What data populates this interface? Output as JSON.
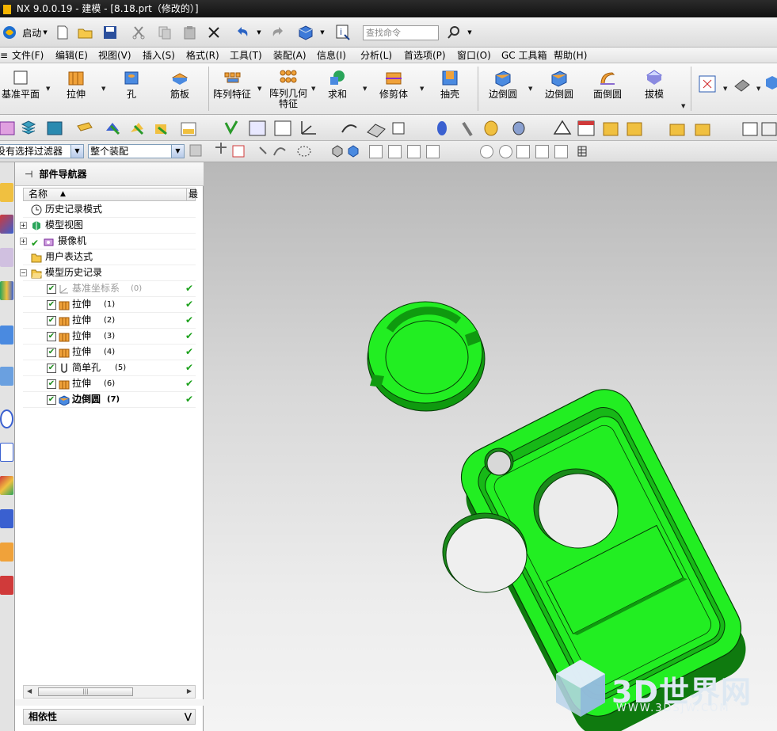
{
  "window": {
    "title": "NX 9.0.0.19 - 建模 - [8.18.prt（修改的）]"
  },
  "quickbar": {
    "start_label": "启动",
    "search_placeholder": "查找命令"
  },
  "menu": [
    {
      "label": "文件(F)"
    },
    {
      "label": "编辑(E)"
    },
    {
      "label": "视图(V)"
    },
    {
      "label": "插入(S)"
    },
    {
      "label": "格式(R)"
    },
    {
      "label": "工具(T)"
    },
    {
      "label": "装配(A)"
    },
    {
      "label": "信息(I)"
    },
    {
      "label": "分析(L)"
    },
    {
      "label": "首选项(P)"
    },
    {
      "label": "窗口(O)"
    },
    {
      "label": "GC 工具箱"
    },
    {
      "label": "帮助(H)"
    }
  ],
  "ribbon": [
    {
      "label": "基准平面",
      "icon": "datum-plane-icon"
    },
    {
      "label": "拉伸",
      "icon": "extrude-icon"
    },
    {
      "label": "孔",
      "icon": "hole-icon"
    },
    {
      "label": "筋板",
      "icon": "rib-icon"
    },
    {
      "label": "阵列特征",
      "icon": "pattern-feature-icon"
    },
    {
      "label": "阵列几何特征",
      "icon": "pattern-geometry-icon"
    },
    {
      "label": "求和",
      "icon": "unite-icon"
    },
    {
      "label": "修剪体",
      "icon": "trim-body-icon"
    },
    {
      "label": "抽壳",
      "icon": "shell-icon"
    },
    {
      "label": "边倒圆",
      "icon": "edge-blend-icon"
    },
    {
      "label": "边倒圆",
      "icon": "edge-blend-icon"
    },
    {
      "label": "面倒圆",
      "icon": "face-blend-icon"
    },
    {
      "label": "拔模",
      "icon": "draft-icon"
    }
  ],
  "filters": {
    "selection_filter": "没有选择过滤器",
    "assembly_scope": "整个装配"
  },
  "navigator": {
    "title": "部件导航器",
    "col_name": "名称",
    "col_latest": "最",
    "deps_title": "相依性",
    "tree": [
      {
        "label": "历史记录模式",
        "icon": "clock-icon"
      },
      {
        "label": "模型视图",
        "icon": "model-view-icon"
      },
      {
        "label": "摄像机",
        "icon": "camera-icon"
      },
      {
        "label": "用户表达式",
        "icon": "folder-icon"
      },
      {
        "label": "模型历史记录",
        "icon": "folder-open-icon"
      },
      {
        "label": "基准坐标系",
        "num": "(0)",
        "icon": "datum-csys-icon"
      },
      {
        "label": "拉伸",
        "num": "(1)",
        "icon": "extrude-icon"
      },
      {
        "label": "拉伸",
        "num": "(2)",
        "icon": "extrude-icon"
      },
      {
        "label": "拉伸",
        "num": "(3)",
        "icon": "extrude-icon"
      },
      {
        "label": "拉伸",
        "num": "(4)",
        "icon": "extrude-icon"
      },
      {
        "label": "简单孔",
        "num": "(5)",
        "icon": "simple-hole-icon"
      },
      {
        "label": "拉伸",
        "num": "(6)",
        "icon": "extrude-icon"
      },
      {
        "label": "边倒圆",
        "num": "(7)",
        "icon": "edge-blend-icon"
      }
    ]
  },
  "watermark": {
    "big": "3D世界网",
    "small": "WWW.3DSJW.COM"
  },
  "colors": {
    "model_green": "#22ee22",
    "model_dark": "#0a7a0a"
  }
}
